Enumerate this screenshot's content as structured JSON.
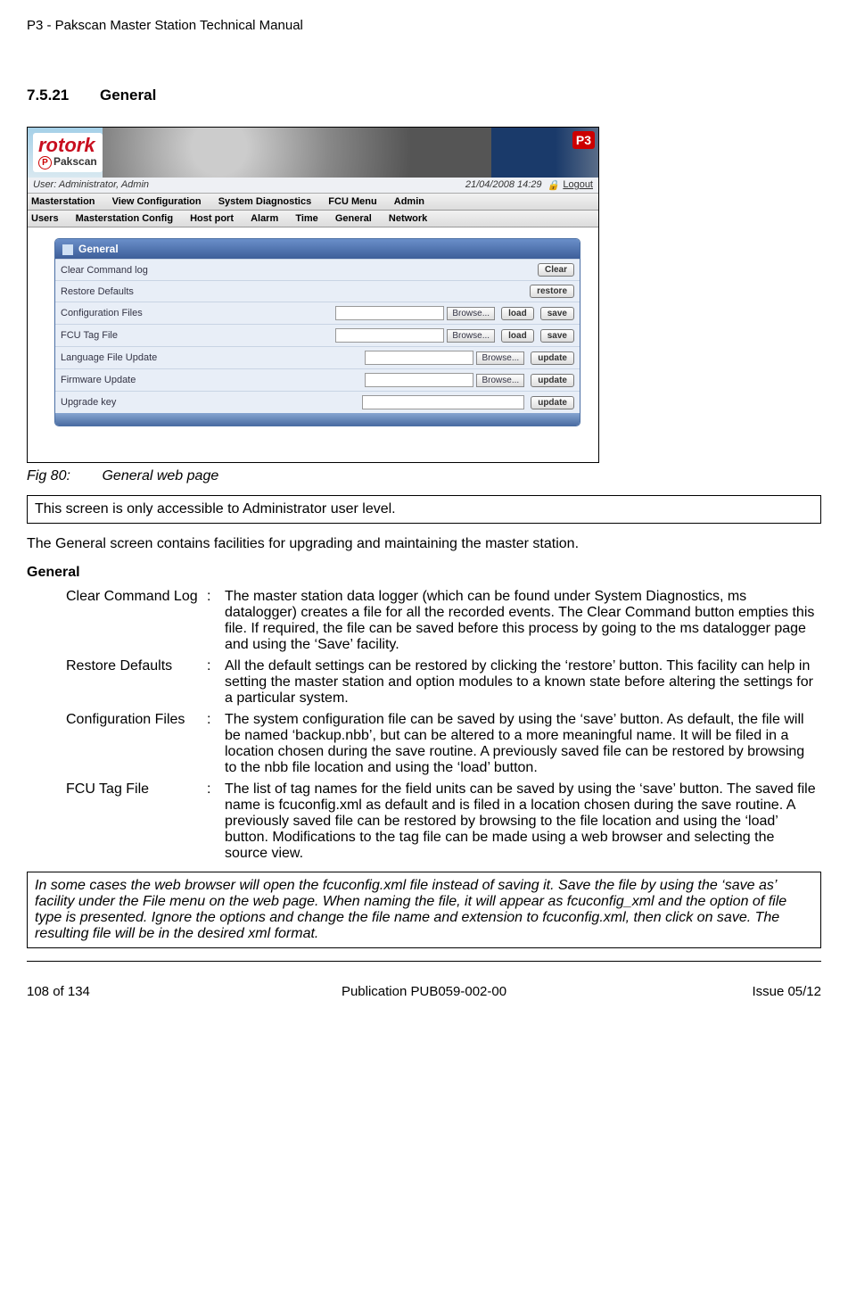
{
  "doc_header": "P3 - Pakscan Master Station Technical Manual",
  "section": {
    "number": "7.5.21",
    "title": "General"
  },
  "screenshot": {
    "logo_top": "rotork",
    "logo_bottom_sym": "P",
    "logo_bottom": "Pakscan",
    "user_label": "User: Administrator, ",
    "user_role": "Admin",
    "datetime": "21/04/2008 14:29",
    "logout": "Logout",
    "menu1": [
      "Masterstation",
      "View Configuration",
      "System Diagnostics",
      "FCU Menu",
      "Admin"
    ],
    "menu2": [
      "Users",
      "Masterstation Config",
      "Host port",
      "Alarm",
      "Time",
      "General",
      "Network"
    ],
    "panel_title": "General",
    "browse": "Browse...",
    "rows": [
      {
        "label": "Clear Command log",
        "controls": "clear"
      },
      {
        "label": "Restore Defaults",
        "controls": "restore"
      },
      {
        "label": "Configuration Files",
        "controls": "file_load_save"
      },
      {
        "label": "FCU Tag File",
        "controls": "file_load_save"
      },
      {
        "label": "Language File Update",
        "controls": "file_update"
      },
      {
        "label": "Firmware Update",
        "controls": "file_update"
      },
      {
        "label": "Upgrade key",
        "controls": "text_update"
      }
    ],
    "btn_clear": "Clear",
    "btn_restore": "restore",
    "btn_load": "load",
    "btn_save": "save",
    "btn_update": "update"
  },
  "fig_caption_num": "Fig 80:",
  "fig_caption_text": "General web page",
  "note1": "This screen is only accessible to Administrator user level.",
  "intro": "The General screen contains facilities for upgrading and maintaining the master station.",
  "subheading": "General",
  "defs": [
    {
      "term": "Clear Command Log",
      "text": "The master station data logger (which can be found under System Diagnostics, ms datalogger) creates a file for all the recorded events. The Clear Command button empties this file. If required, the file can be saved before this process by going to the ms datalogger page and using the ‘Save’ facility."
    },
    {
      "term": "Restore Defaults",
      "text": "All the default settings can be restored by clicking the ‘restore’ button. This facility can help in setting the master station and option modules to a known state before altering the settings for a particular system."
    },
    {
      "term": "Configuration Files",
      "text": "The system configuration file can be saved by using the ‘save’ button. As default, the file will be named ‘backup.nbb’, but can be altered to a more meaningful name.  It will be filed in a location chosen during the save routine. A previously saved file can be restored by browsing to the nbb file location and using the ‘load’ button."
    },
    {
      "term": "FCU Tag File",
      "text": "The list of tag names for the field units can be saved by using the ‘save’ button. The saved file name is fcuconfig.xml as default and is filed in a location chosen during the save routine. A previously saved file can be restored by browsing to the file location and using the ‘load’ button. Modifications to the tag file can be made using a web browser and selecting the source view."
    }
  ],
  "note2": "In some cases the web browser will open the fcuconfig.xml file instead of saving it. Save the file by using the ‘save as’ facility under the File menu on the web page. When naming the file, it will appear as fcuconfig_xml and the option of file type is presented. Ignore the options and change the file name and extension to fcuconfig.xml, then click on save. The resulting file will be in the desired xml format.",
  "footer": {
    "left": "108 of 134",
    "center": "Publication PUB059-002-00",
    "right": "Issue 05/12"
  }
}
